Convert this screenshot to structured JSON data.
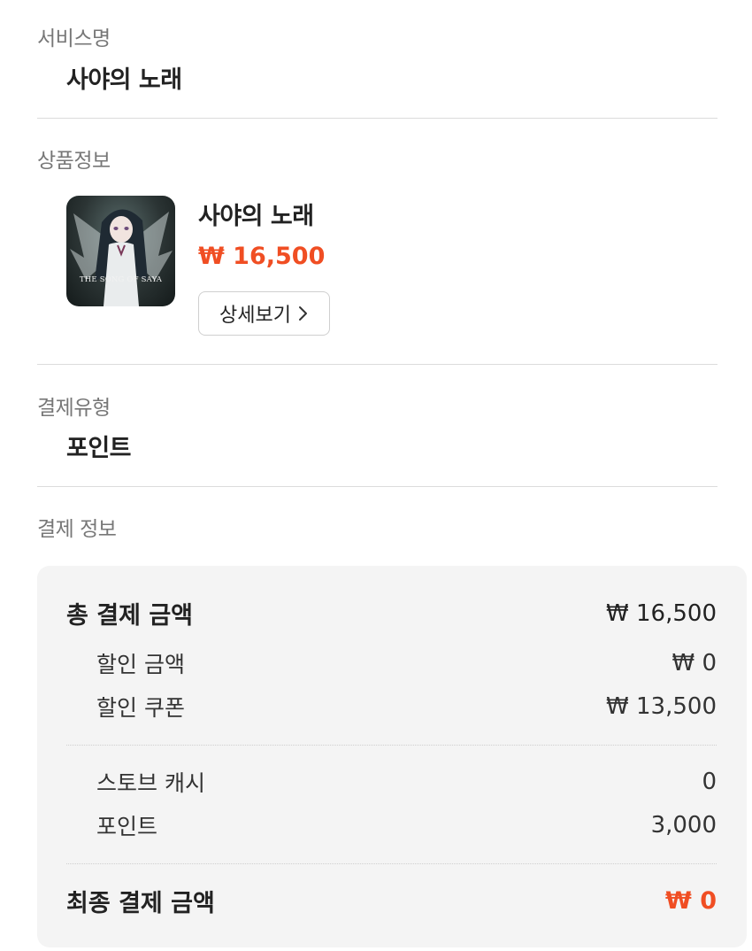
{
  "service": {
    "label": "서비스명",
    "name": "사야의 노래"
  },
  "product": {
    "label": "상품정보",
    "thumbnail_caption": "THE SONG OF SAYA",
    "title": "사야의 노래",
    "price": "₩ 16,500",
    "detail_button": "상세보기",
    "price_color": "#f04e23"
  },
  "payment_type": {
    "label": "결제유형",
    "value": "포인트"
  },
  "payment_info": {
    "label": "결제 정보",
    "rows": [
      {
        "label": "총 결제 금액",
        "value": "₩ 16,500"
      },
      {
        "label": "할인 금액",
        "value": "₩ 0"
      },
      {
        "label": "할인 쿠폰",
        "value": "₩ 13,500"
      },
      {
        "label": "스토브 캐시",
        "value": "0"
      },
      {
        "label": "포인트",
        "value": "3,000"
      },
      {
        "label": "최종 결제 금액",
        "value": "₩ 0"
      }
    ]
  }
}
